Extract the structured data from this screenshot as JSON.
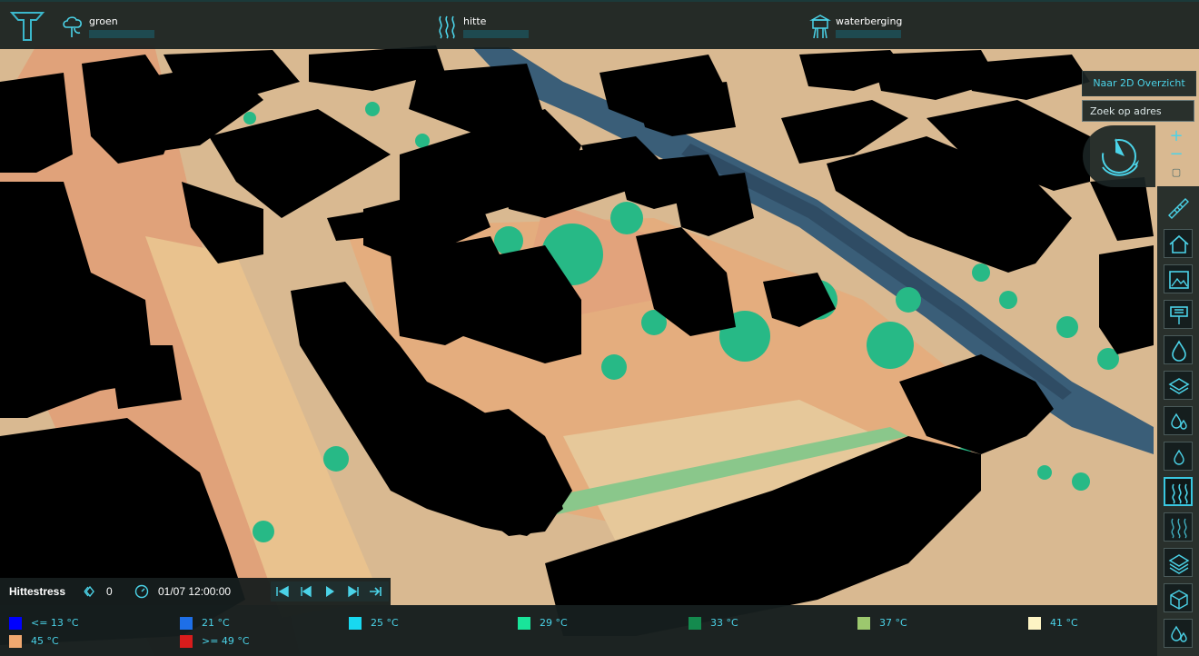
{
  "header": {
    "indicators": [
      {
        "name": "groen",
        "icon": "tree-cloud-icon",
        "progress": 0
      },
      {
        "name": "hitte",
        "icon": "heat-waves-icon",
        "progress": 0
      },
      {
        "name": "waterberging",
        "icon": "water-tower-icon",
        "progress": 0
      }
    ]
  },
  "map_controls": {
    "to_2d_label": "Naar 2D Overzicht",
    "search_placeholder": "Zoek op adres",
    "zoom_in": "+",
    "zoom_out": "−"
  },
  "toolbar": {
    "tools": [
      "ruler-icon",
      "house-icon",
      "picture-icon",
      "sign-icon",
      "water-drop-icon",
      "layers-icon",
      "water-drops-icon",
      "water-drop-small-icon",
      "heat-waves-icon",
      "heat-waves-alt-icon",
      "layers-stack-icon",
      "box-icon",
      "water-drop-bottom-icon"
    ],
    "active_tool": "heat-waves-icon"
  },
  "info": {
    "layer_title": "Hittestress",
    "layer_value": "0",
    "datetime": "01/07 12:00:00"
  },
  "legend": {
    "items": [
      {
        "label": "<= 13 °C",
        "color": "#0000ff"
      },
      {
        "label": "21 °C",
        "color": "#1e6fe8"
      },
      {
        "label": "25 °C",
        "color": "#18d8f0"
      },
      {
        "label": "29 °C",
        "color": "#19e49a"
      },
      {
        "label": "33 °C",
        "color": "#148a4e"
      },
      {
        "label": "37 °C",
        "color": "#9cc86e"
      },
      {
        "label": "41 °C",
        "color": "#fdf4c4"
      },
      {
        "label": "45 °C",
        "color": "#f0a870"
      },
      {
        "label": ">= 49 °C",
        "color": "#d81c1c"
      }
    ]
  },
  "colors": {
    "accent": "#4bd3e8",
    "building": "#000000",
    "ground": "#ddb58c",
    "water": "#3a5e78",
    "green": "#27b986"
  }
}
